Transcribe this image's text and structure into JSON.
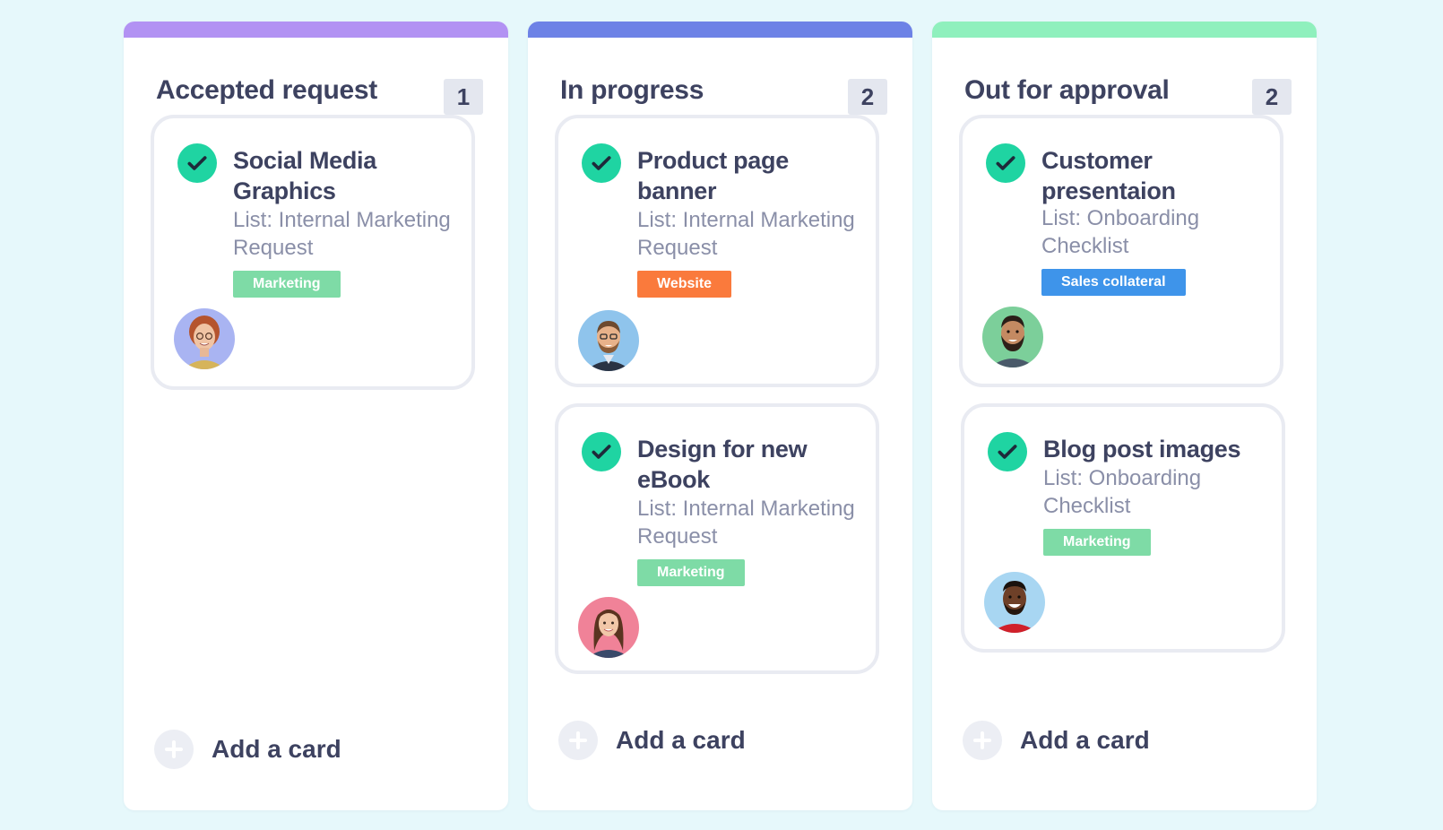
{
  "colors": {
    "page_bg": "#e6f8fb",
    "check": "#1fd4a2",
    "tag_marketing": "#7edba6",
    "tag_website": "#fa7a3c",
    "tag_sales": "#3e94ea"
  },
  "columns": [
    {
      "title": "Accepted request",
      "count": "1",
      "accent": "#b292f3",
      "add_label": "Add a card",
      "cards": [
        {
          "title": "Social Media Graphics",
          "list": "List: Internal Marketing Request",
          "tag": "Marketing",
          "avatar": "avatar-woman-red-hair"
        }
      ]
    },
    {
      "title": "In progress",
      "count": "2",
      "accent": "#6d82e6",
      "add_label": "Add a card",
      "cards": [
        {
          "title": "Product page banner",
          "list": "List: Internal Marketing Request",
          "tag": "Website",
          "avatar": "avatar-man-glasses"
        },
        {
          "title": "Design for new eBook",
          "list": "List: Internal Marketing Request",
          "tag": "Marketing",
          "avatar": "avatar-woman-brown-hair"
        }
      ]
    },
    {
      "title": "Out for approval",
      "count": "2",
      "accent": "#8ff0bd",
      "add_label": "Add a card",
      "cards": [
        {
          "title": "Customer presentaion",
          "list": "List: Onboarding Checklist",
          "tag": "Sales collateral",
          "avatar": "avatar-man-beard"
        },
        {
          "title": "Blog post images",
          "list": "List: Onboarding Checklist",
          "tag": "Marketing",
          "avatar": "avatar-man-smiling"
        }
      ]
    }
  ]
}
